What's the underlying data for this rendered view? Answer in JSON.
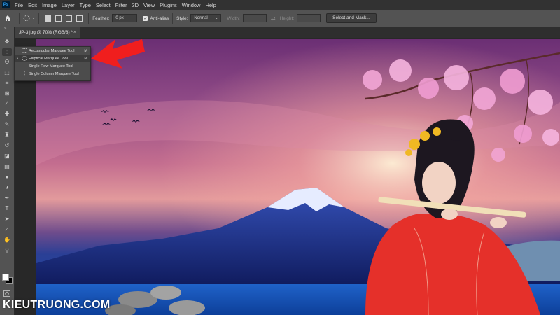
{
  "menu": {
    "items": [
      "File",
      "Edit",
      "Image",
      "Layer",
      "Type",
      "Select",
      "Filter",
      "3D",
      "View",
      "Plugins",
      "Window",
      "Help"
    ],
    "app_logo_text": "Ps"
  },
  "options": {
    "feather_label": "Feather:",
    "feather_value": "0 px",
    "antialias_label": "Anti-alias",
    "style_label": "Style:",
    "style_value": "Normal",
    "width_label": "Width:",
    "height_label": "Height:",
    "select_mask_label": "Select and Mask..."
  },
  "document": {
    "tab_title": "JP-3.jpg @ 70% (RGB/8) *",
    "close_symbol": "×"
  },
  "flyout": {
    "items": [
      {
        "label": "Rectangular Marquee Tool",
        "shortcut": "M",
        "selected": false,
        "icon": "rect-marquee-icon"
      },
      {
        "label": "Elliptical Marquee Tool",
        "shortcut": "M",
        "selected": true,
        "icon": "ellipse-marquee-icon"
      },
      {
        "label": "Single Row Marquee Tool",
        "shortcut": "",
        "selected": false,
        "icon": "row-marquee-icon"
      },
      {
        "label": "Single Column Marquee Tool",
        "shortcut": "",
        "selected": false,
        "icon": "column-marquee-icon"
      }
    ],
    "bullet": "•"
  },
  "tools": [
    {
      "name": "move-tool-icon",
      "glyph": "✥"
    },
    {
      "name": "marquee-tool-icon",
      "glyph": "◌"
    },
    {
      "name": "lasso-tool-icon",
      "glyph": "ʘ"
    },
    {
      "name": "object-select-tool-icon",
      "glyph": "⬚"
    },
    {
      "name": "crop-tool-icon",
      "glyph": "⌗"
    },
    {
      "name": "frame-tool-icon",
      "glyph": "⊠"
    },
    {
      "name": "eyedropper-tool-icon",
      "glyph": "⁄"
    },
    {
      "name": "healing-brush-tool-icon",
      "glyph": "✚"
    },
    {
      "name": "brush-tool-icon",
      "glyph": "✎"
    },
    {
      "name": "stamp-tool-icon",
      "glyph": "♜"
    },
    {
      "name": "history-brush-tool-icon",
      "glyph": "↺"
    },
    {
      "name": "eraser-tool-icon",
      "glyph": "◪"
    },
    {
      "name": "gradient-tool-icon",
      "glyph": "▤"
    },
    {
      "name": "blur-tool-icon",
      "glyph": "●"
    },
    {
      "name": "dodge-tool-icon",
      "glyph": "◕"
    },
    {
      "name": "pen-tool-icon",
      "glyph": "✒"
    },
    {
      "name": "type-tool-icon",
      "glyph": "T"
    },
    {
      "name": "path-select-tool-icon",
      "glyph": "➤"
    },
    {
      "name": "line-tool-icon",
      "glyph": "∕"
    },
    {
      "name": "hand-tool-icon",
      "glyph": "✋"
    },
    {
      "name": "zoom-tool-icon",
      "glyph": "⚲"
    },
    {
      "name": "more-tools-icon",
      "glyph": "···"
    }
  ],
  "watermark": "KIEUTRUONG.COM",
  "colors": {
    "panel": "#535353",
    "menubar": "#323232",
    "annotation_arrow": "#f01e1e"
  }
}
